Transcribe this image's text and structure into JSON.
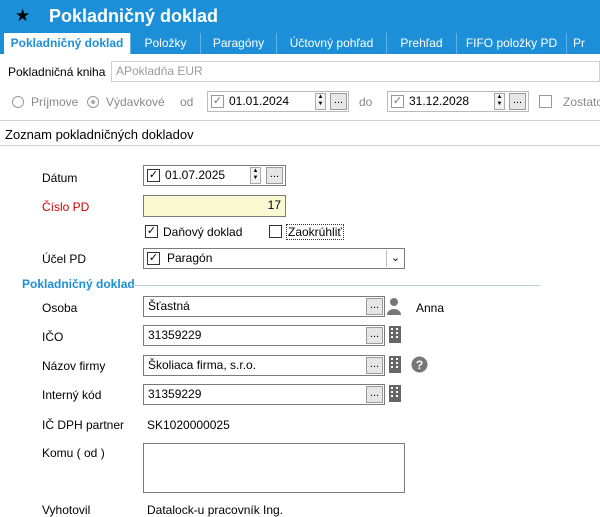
{
  "window": {
    "title": "Pokladničný doklad"
  },
  "tabs": [
    "Pokladničný doklad",
    "Položky",
    "Paragóny",
    "Účtovný pohľad",
    "Prehľad",
    "FIFO položky PD",
    "Pr"
  ],
  "filter": {
    "book_label": "Pokladničná kniha",
    "book_value": "APokladňa EUR",
    "radio_income": "Príjmove",
    "radio_expense": "Výdavkové",
    "from_label": "od",
    "from_value": "01.01.2024",
    "to_label": "do",
    "to_value": "31.12.2028",
    "zostatok_label": "Zostato"
  },
  "section_title": "Zoznam pokladničných dokladov",
  "form": {
    "date_label": "Dátum",
    "date_value": "01.07.2025",
    "number_label": "Číslo PD",
    "number_value": "17",
    "tax_doc_label": "Daňový doklad",
    "round_label": "Zaokrúhliť",
    "purpose_label": "Účel PD",
    "purpose_value": "Paragón"
  },
  "group_title": "Pokladničný doklad",
  "person": {
    "label": "Osoba",
    "value": "Šťastná",
    "extra": "Anna",
    "ico_label": "IČO",
    "ico_value": "31359229",
    "firm_label": "Názov firmy",
    "firm_value": "Školiaca firma, s.r.o.",
    "internal_label": "Interný kód",
    "internal_value": "31359229",
    "vat_label": "IČ DPH partner",
    "vat_value": "SK1020000025",
    "to_label": "Komu ( od )",
    "to_value": "",
    "issued_label": "Vyhotovil",
    "issued_value": "Datalock-u pracovník Ing."
  },
  "colors": {
    "accent": "#1c8fd8",
    "required_label": "#d00000",
    "highlight_field": "#fafad2"
  },
  "icons": [
    "star-icon",
    "person-icon",
    "building-icon",
    "help-icon",
    "chevron-down-icon",
    "check-icon"
  ]
}
